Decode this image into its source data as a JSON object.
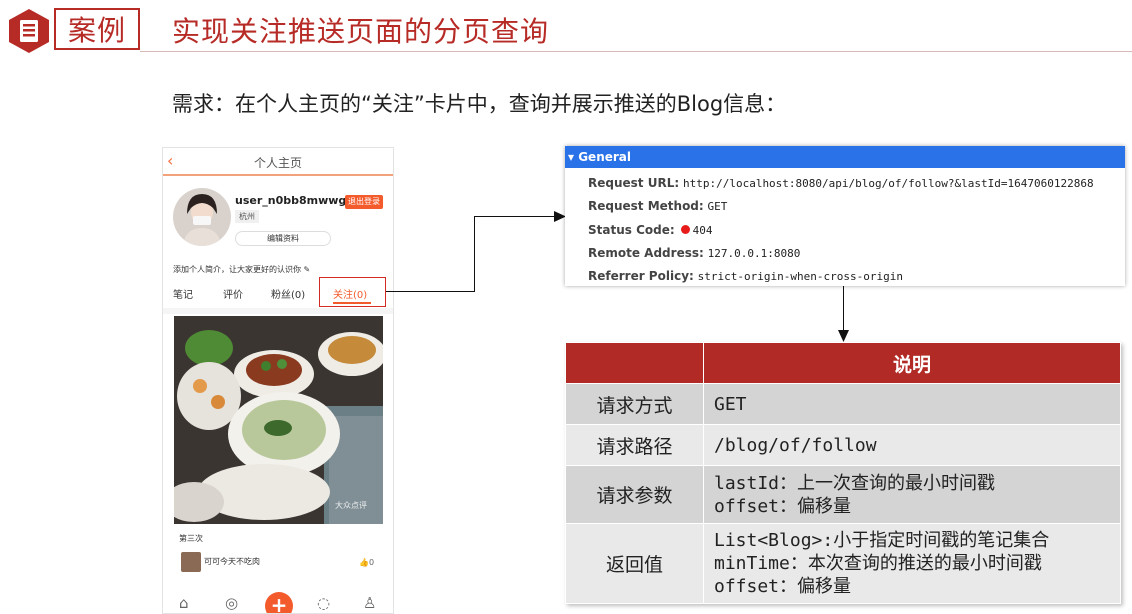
{
  "header": {
    "badge": "案例",
    "title": "实现关注推送页面的分页查询"
  },
  "requirement": "需求：在个人主页的“关注”卡片中，查询并展示推送的Blog信息：",
  "phone": {
    "back": "‹",
    "title": "个人主页",
    "username": "user_n0bb8mwwg4",
    "logout": "退出登录",
    "city": "杭州",
    "edit": "编辑资料",
    "bio": "添加个人简介，让大家更好的认识你 ✎",
    "tabs": [
      "笔记",
      "评价",
      "粉丝(0)",
      "关注(0)"
    ],
    "watermark": "大众点评",
    "caption": "第三次",
    "author": "可可今天不吃肉",
    "likes": "0",
    "nav_add": "+"
  },
  "general": {
    "title": "▾ General",
    "rows": [
      {
        "key": "Request URL:",
        "value": "http://localhost:8080/api/blog/of/follow?&lastId=1647060122868"
      },
      {
        "key": "Request Method:",
        "value": "GET"
      },
      {
        "key": "Status Code:",
        "value": "404"
      },
      {
        "key": "Remote Address:",
        "value": "127.0.0.1:8080"
      },
      {
        "key": "Referrer Policy:",
        "value": "strict-origin-when-cross-origin"
      }
    ]
  },
  "table": {
    "header": "说明",
    "rows": [
      {
        "key": "请求方式",
        "lines": [
          "GET"
        ]
      },
      {
        "key": "请求路径",
        "lines": [
          "/blog/of/follow"
        ]
      },
      {
        "key": "请求参数",
        "lines": [
          "lastId：上一次查询的最小时间戳",
          "offset：偏移量"
        ]
      },
      {
        "key": "返回值",
        "lines": [
          "List<Blog>:小于指定时间戳的笔记集合",
          "minTime：本次查询的推送的最小时间戳",
          "offset：偏移量"
        ]
      }
    ]
  },
  "colors": {
    "accent": "#b72b27",
    "general_header": "#2a72e8",
    "table_header": "#b22a25",
    "phone_accent": "#f35b2d"
  }
}
